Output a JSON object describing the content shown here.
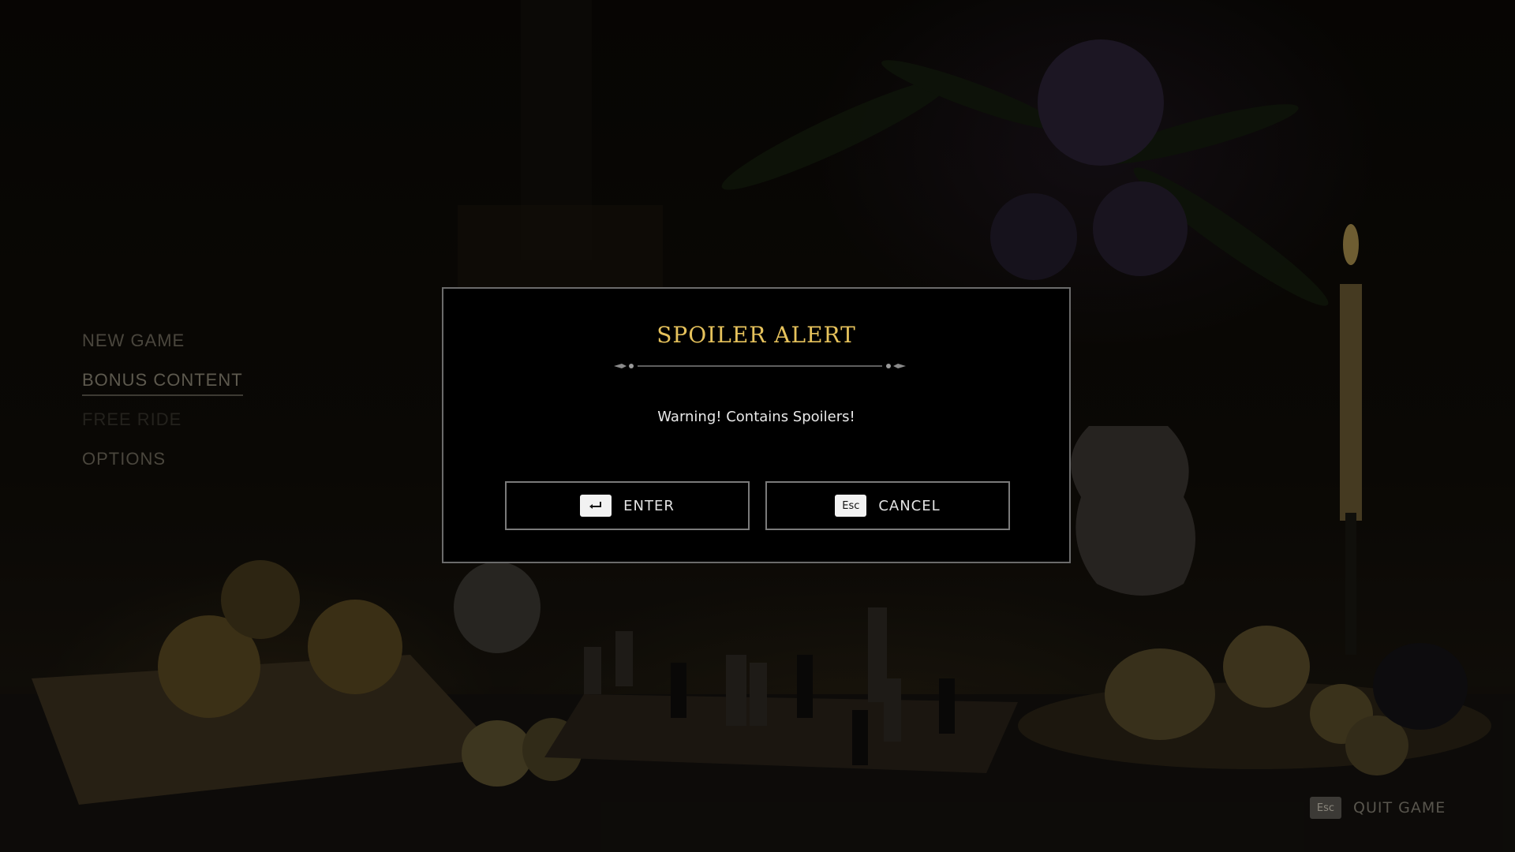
{
  "main_menu": {
    "items": [
      {
        "label": "NEW GAME",
        "state": "normal"
      },
      {
        "label": "BONUS CONTENT",
        "state": "selected"
      },
      {
        "label": "FREE RIDE",
        "state": "disabled"
      },
      {
        "label": "OPTIONS",
        "state": "normal"
      }
    ]
  },
  "dialog": {
    "title": "SPOILER ALERT",
    "message": "Warning! Contains Spoilers!",
    "confirm": {
      "key_icon": "enter-key-icon",
      "label": "ENTER"
    },
    "cancel": {
      "key": "Esc",
      "label": "CANCEL"
    }
  },
  "footer": {
    "quit_key": "Esc",
    "quit_label": "QUIT GAME"
  },
  "colors": {
    "title_gold": "#e6c25c",
    "dialog_border": "#6b6b6b",
    "menu_text": "#4a463d"
  }
}
